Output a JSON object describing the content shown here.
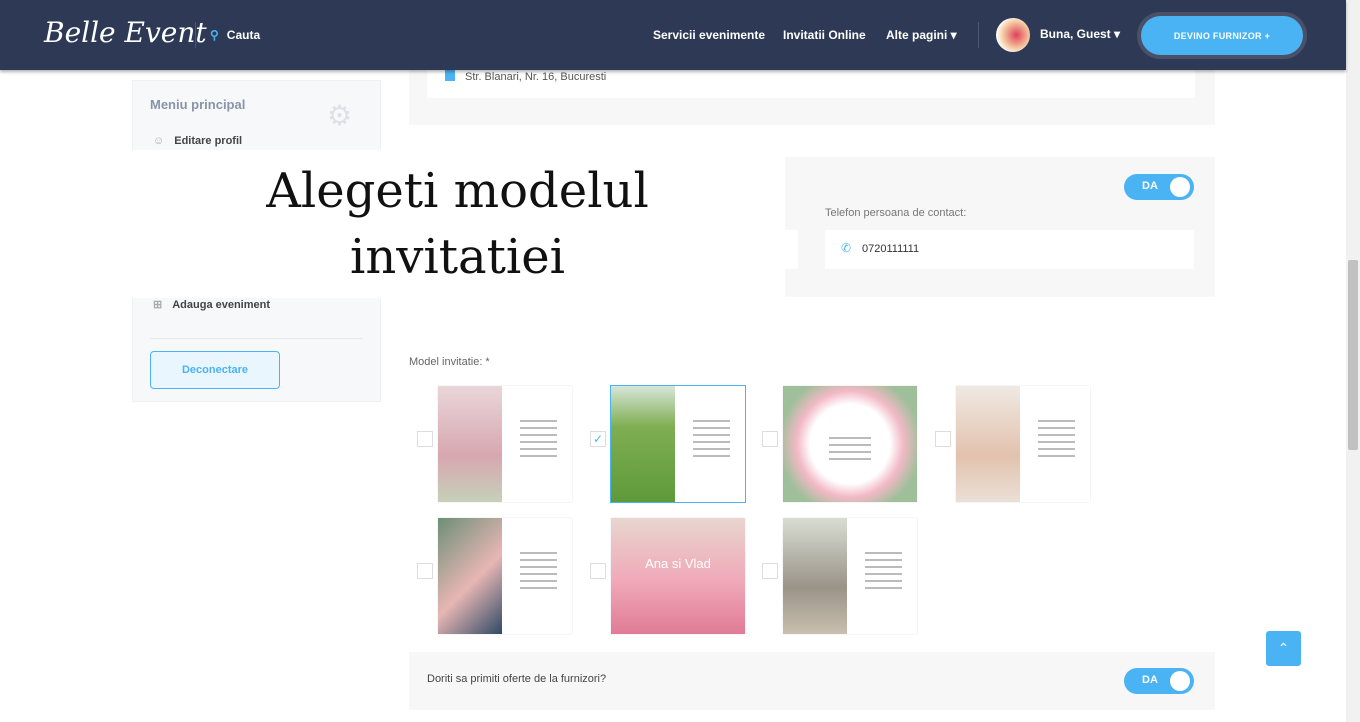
{
  "nav": {
    "logo": "Belle Event",
    "search": "Cauta",
    "links": [
      "Servicii evenimente",
      "Invitatii Online",
      "Alte pagini ▾"
    ],
    "user": "Buna, Guest ▾",
    "cta": "DEVINO FURNIZOR +"
  },
  "address": "Str. Blanari, Nr. 16, Bucuresti",
  "sidebar": {
    "title": "Meniu principal",
    "items": [
      "Editare profil",
      "Adauga eveniment"
    ],
    "logout": "Deconectare"
  },
  "overlay": {
    "line1": "Alegeti modelul",
    "line2": "invitatiei"
  },
  "contact": {
    "toggle": "DA",
    "phone_label": "Telefon persoana de contact:",
    "phone_value": "0720111111"
  },
  "model": {
    "label": "Model invitatie: *",
    "selected_index": 1,
    "center_text": "Ana si Vlad"
  },
  "offers": {
    "question": "Doriti sa primiti oferte de la furnizori?",
    "toggle": "DA"
  },
  "accent": "#4ab3f4"
}
